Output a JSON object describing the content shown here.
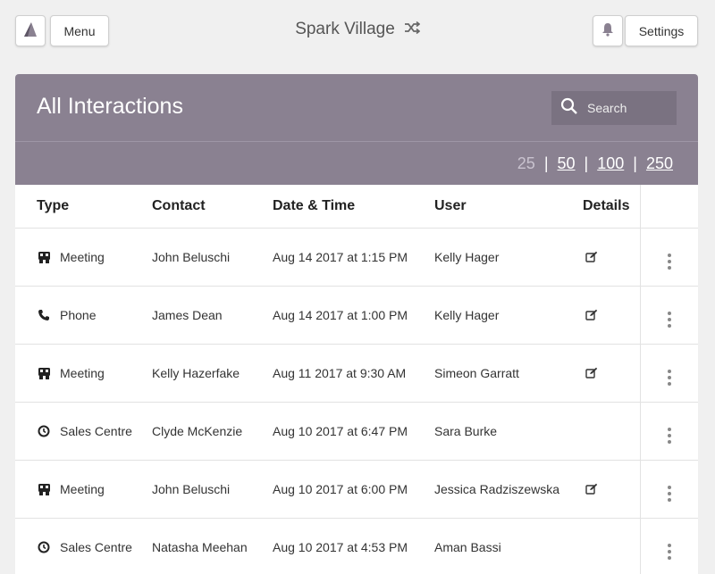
{
  "header": {
    "menu_label": "Menu",
    "app_title": "Spark Village",
    "settings_label": "Settings"
  },
  "card": {
    "title": "All Interactions",
    "search_label": "Search",
    "page_sizes": {
      "current": "25",
      "options": [
        "50",
        "100",
        "250"
      ]
    }
  },
  "table": {
    "columns": [
      "Type",
      "Contact",
      "Date & Time",
      "User",
      "Details"
    ],
    "rows": [
      {
        "type": "Meeting",
        "type_icon": "meeting-icon",
        "contact": "John Beluschi",
        "datetime": "Aug 14 2017 at 1:15 PM",
        "user": "Kelly Hager",
        "has_details": true
      },
      {
        "type": "Phone",
        "type_icon": "phone-icon",
        "contact": "James Dean",
        "datetime": "Aug 14 2017 at 1:00 PM",
        "user": "Kelly Hager",
        "has_details": true
      },
      {
        "type": "Meeting",
        "type_icon": "meeting-icon",
        "contact": "Kelly Hazerfake",
        "datetime": "Aug 11 2017 at 9:30 AM",
        "user": "Simeon Garratt",
        "has_details": true
      },
      {
        "type": "Sales Centre",
        "type_icon": "clock-icon",
        "contact": "Clyde McKenzie",
        "datetime": "Aug 10 2017 at 6:47 PM",
        "user": "Sara Burke",
        "has_details": false
      },
      {
        "type": "Meeting",
        "type_icon": "meeting-icon",
        "contact": "John Beluschi",
        "datetime": "Aug 10 2017 at 6:00 PM",
        "user": "Jessica Radziszewska",
        "has_details": true
      },
      {
        "type": "Sales Centre",
        "type_icon": "clock-icon",
        "contact": "Natasha Meehan",
        "datetime": "Aug 10 2017 at 4:53 PM",
        "user": "Aman Bassi",
        "has_details": false
      }
    ]
  },
  "colors": {
    "card_header": "#8a8191",
    "search_bg": "#7a7281"
  }
}
